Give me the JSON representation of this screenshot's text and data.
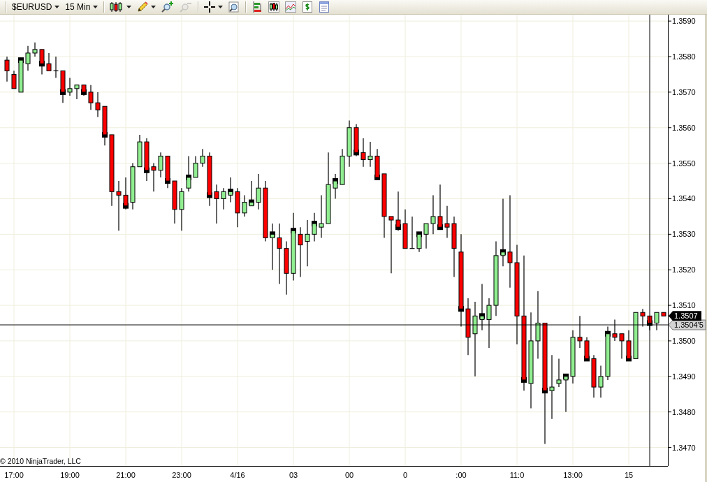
{
  "toolbar": {
    "instrument": {
      "label": "$EURUSD"
    },
    "interval": {
      "label": "15 Min"
    },
    "tools": [
      {
        "disabled": false
      },
      {
        "disabled": false
      },
      {
        "disabled": false
      },
      {
        "disabled": true
      },
      {
        "disabled": false
      },
      {
        "disabled": false
      },
      {
        "disabled": false
      },
      {
        "disabled": false
      },
      {
        "disabled": false
      },
      {
        "disabled": false
      },
      {
        "disabled": false
      }
    ]
  },
  "chart": {
    "copyright": "© 2010 NinjaTrader, LLC",
    "bar_marks": [
      false,
      false,
      true,
      false,
      false,
      true,
      false,
      false,
      true,
      false,
      false,
      true,
      false,
      false,
      true,
      false,
      false,
      true,
      false,
      false,
      true,
      false,
      false,
      true,
      false,
      false,
      true,
      false,
      false,
      true,
      false,
      false,
      true,
      false,
      false,
      true,
      false,
      false,
      true,
      false,
      false,
      true,
      false,
      false,
      true,
      false,
      false,
      true,
      false,
      false,
      true,
      false,
      false,
      true,
      false,
      false,
      true,
      false,
      false,
      true,
      false,
      false,
      true,
      false,
      false,
      true,
      false,
      false,
      true,
      false,
      false,
      true,
      false,
      false,
      true,
      false,
      false,
      true,
      false,
      false,
      true,
      false,
      false,
      true,
      false,
      false,
      true,
      false,
      false,
      true,
      false,
      false,
      true,
      false,
      false
    ],
    "chart_data": {
      "type": "candlestick",
      "categories": [
        null,
        "17:00",
        null,
        null,
        null,
        null,
        null,
        null,
        null,
        "19:00",
        null,
        null,
        null,
        null,
        null,
        null,
        null,
        "21:00",
        null,
        null,
        null,
        null,
        null,
        null,
        null,
        "23:00",
        null,
        null,
        null,
        null,
        null,
        null,
        null,
        "4/16",
        null,
        null,
        null,
        null,
        null,
        null,
        null,
        "03",
        null,
        null,
        null,
        null,
        null,
        null,
        null,
        "00",
        null,
        null,
        null,
        null,
        null,
        null,
        null,
        "0",
        null,
        null,
        null,
        null,
        null,
        null,
        null,
        ":00",
        null,
        null,
        null,
        null,
        null,
        null,
        null,
        "11:0",
        null,
        null,
        null,
        null,
        null,
        null,
        null,
        "13:00",
        null,
        null,
        null,
        null,
        null,
        null,
        null,
        "15",
        null,
        null,
        null,
        null,
        null
      ],
      "ylim": [
        1.34648,
        1.35918
      ],
      "yticks": [
        {
          "value": 1.359,
          "label": "1.3590"
        },
        {
          "value": 1.358,
          "label": "1.3580"
        },
        {
          "value": 1.357,
          "label": "1.3570"
        },
        {
          "value": 1.356,
          "label": "1.3560"
        },
        {
          "value": 1.355,
          "label": "1.3550"
        },
        {
          "value": 1.354,
          "label": "1.3540"
        },
        {
          "value": 1.353,
          "label": "1.3530"
        },
        {
          "value": 1.352,
          "label": "1.3520"
        },
        {
          "value": 1.351,
          "label": "1.3510"
        },
        {
          "value": 1.35,
          "label": "1.3500"
        },
        {
          "value": 1.349,
          "label": "1.3490"
        },
        {
          "value": 1.348,
          "label": "1.3480"
        },
        {
          "value": 1.347,
          "label": "1.3470"
        }
      ],
      "ohlc": [
        [
          1.3579,
          1.358,
          1.3573,
          1.3576
        ],
        [
          1.3575,
          1.3576,
          1.3571,
          1.3571
        ],
        [
          1.357,
          1.3579,
          1.357,
          1.3579
        ],
        [
          1.3578,
          1.3583,
          1.3576,
          1.3581
        ],
        [
          1.3581,
          1.3584,
          1.358,
          1.3582
        ],
        [
          1.3582,
          1.3582,
          1.3575,
          1.3578
        ],
        [
          1.3578,
          1.3581,
          1.3576,
          1.3576
        ],
        [
          1.3576,
          1.358,
          1.3574,
          1.3576
        ],
        [
          1.3576,
          1.3576,
          1.3567,
          1.357
        ],
        [
          1.357,
          1.3574,
          1.3569,
          1.3571
        ],
        [
          1.3571,
          1.3572,
          1.3568,
          1.3572
        ],
        [
          1.3572,
          1.3572,
          1.3569,
          1.357
        ],
        [
          1.357,
          1.3572,
          1.3565,
          1.3567
        ],
        [
          1.3567,
          1.357,
          1.3563,
          1.3565
        ],
        [
          1.3566,
          1.3566,
          1.3555,
          1.3558
        ],
        [
          1.3558,
          1.3558,
          1.3538,
          1.3542
        ],
        [
          1.3542,
          1.3545,
          1.3531,
          1.3541
        ],
        [
          1.3541,
          1.3546,
          1.3537,
          1.3538
        ],
        [
          1.3539,
          1.355,
          1.3537,
          1.3549
        ],
        [
          1.3549,
          1.3558,
          1.3549,
          1.3556
        ],
        [
          1.3556,
          1.3557,
          1.3545,
          1.3548
        ],
        [
          1.3549,
          1.355,
          1.3542,
          1.3548
        ],
        [
          1.3548,
          1.3553,
          1.3546,
          1.3552
        ],
        [
          1.3552,
          1.3552,
          1.3543,
          1.3545
        ],
        [
          1.3545,
          1.3545,
          1.3533,
          1.3537
        ],
        [
          1.3537,
          1.3543,
          1.3531,
          1.3542
        ],
        [
          1.3543,
          1.3552,
          1.3542,
          1.3546
        ],
        [
          1.3546,
          1.3552,
          1.3546,
          1.355
        ],
        [
          1.355,
          1.3554,
          1.3549,
          1.3552
        ],
        [
          1.3552,
          1.3553,
          1.3538,
          1.3541
        ],
        [
          1.3542,
          1.3544,
          1.3533,
          1.354
        ],
        [
          1.354,
          1.3543,
          1.3537,
          1.3542
        ],
        [
          1.3541,
          1.3546,
          1.3539,
          1.3542
        ],
        [
          1.3542,
          1.3543,
          1.3532,
          1.3536
        ],
        [
          1.3536,
          1.3541,
          1.3535,
          1.3539
        ],
        [
          1.3538,
          1.3545,
          1.3538,
          1.3539
        ],
        [
          1.3539,
          1.3547,
          1.3537,
          1.3543
        ],
        [
          1.3543,
          1.3545,
          1.3528,
          1.3529
        ],
        [
          1.3529,
          1.3533,
          1.352,
          1.353
        ],
        [
          1.3529,
          1.3533,
          1.3516,
          1.3526
        ],
        [
          1.3526,
          1.3528,
          1.3513,
          1.3519
        ],
        [
          1.3519,
          1.3536,
          1.3517,
          1.3531
        ],
        [
          1.353,
          1.3532,
          1.3518,
          1.3527
        ],
        [
          1.3528,
          1.3534,
          1.3521,
          1.353
        ],
        [
          1.353,
          1.3536,
          1.3528,
          1.3533
        ],
        [
          1.3532,
          1.3541,
          1.3529,
          1.3533
        ],
        [
          1.3533,
          1.3553,
          1.3533,
          1.3544
        ],
        [
          1.3543,
          1.3547,
          1.354,
          1.3545
        ],
        [
          1.3544,
          1.3554,
          1.3544,
          1.3552
        ],
        [
          1.3552,
          1.3562,
          1.3549,
          1.356
        ],
        [
          1.356,
          1.3561,
          1.3552,
          1.3553
        ],
        [
          1.3553,
          1.3557,
          1.3549,
          1.3551
        ],
        [
          1.3551,
          1.3556,
          1.3549,
          1.3552
        ],
        [
          1.3552,
          1.3554,
          1.3546,
          1.3546
        ],
        [
          1.3547,
          1.3547,
          1.3529,
          1.3535
        ],
        [
          1.3535,
          1.3535,
          1.3519,
          1.3534
        ],
        [
          1.3534,
          1.3542,
          1.3531,
          1.3532
        ],
        [
          1.3533,
          1.3537,
          1.3526,
          1.3526
        ],
        [
          1.3526,
          1.3535,
          1.3526,
          1.3526
        ],
        [
          1.3526,
          1.353,
          1.3525,
          1.353
        ],
        [
          1.353,
          1.3533,
          1.3526,
          1.3533
        ],
        [
          1.3533,
          1.3541,
          1.353,
          1.3535
        ],
        [
          1.3535,
          1.3544,
          1.3532,
          1.3532
        ],
        [
          1.3533,
          1.3538,
          1.3529,
          1.3532
        ],
        [
          1.3533,
          1.3535,
          1.3518,
          1.3526
        ],
        [
          1.3525,
          1.353,
          1.3504,
          1.3509
        ],
        [
          1.3509,
          1.3512,
          1.3496,
          1.3501
        ],
        [
          1.3502,
          1.3511,
          1.349,
          1.3507
        ],
        [
          1.3506,
          1.3516,
          1.3503,
          1.3507
        ],
        [
          1.3506,
          1.3512,
          1.3498,
          1.351
        ],
        [
          1.351,
          1.3528,
          1.3507,
          1.3524
        ],
        [
          1.3524,
          1.354,
          1.3521,
          1.3525
        ],
        [
          1.3525,
          1.3541,
          1.3515,
          1.3522
        ],
        [
          1.3522,
          1.3527,
          1.3499,
          1.3507
        ],
        [
          1.3507,
          1.3524,
          1.3486,
          1.3489
        ],
        [
          1.3488,
          1.3508,
          1.3481,
          1.35
        ],
        [
          1.35,
          1.3514,
          1.3495,
          1.3505
        ],
        [
          1.3505,
          1.3505,
          1.3471,
          1.3486
        ],
        [
          1.3486,
          1.3496,
          1.3478,
          1.3487
        ],
        [
          1.3488,
          1.3495,
          1.3487,
          1.3489
        ],
        [
          1.3489,
          1.349,
          1.348,
          1.349
        ],
        [
          1.349,
          1.3503,
          1.3488,
          1.3501
        ],
        [
          1.3501,
          1.3507,
          1.3498,
          1.35
        ],
        [
          1.35,
          1.3501,
          1.3495,
          1.3495
        ],
        [
          1.3495,
          1.3496,
          1.3484,
          1.3487
        ],
        [
          1.3487,
          1.3493,
          1.3484,
          1.349
        ],
        [
          1.349,
          1.3504,
          1.3489,
          1.3502
        ],
        [
          1.3502,
          1.3506,
          1.35,
          1.3501
        ],
        [
          1.3502,
          1.3502,
          1.3495,
          1.35
        ],
        [
          1.35,
          1.3503,
          1.3495,
          1.3495
        ],
        [
          1.3495,
          1.3508,
          1.3495,
          1.3508
        ],
        [
          1.3508,
          1.3509,
          1.3504,
          1.3507
        ],
        [
          1.3507,
          1.3507,
          1.3503,
          1.3505
        ],
        [
          1.3505,
          1.3508,
          1.3503,
          1.3508
        ],
        [
          1.3508,
          1.3508,
          1.3507,
          1.3507
        ]
      ],
      "grid": true,
      "ref_lines": [
        {
          "axis": "y",
          "value": 1.35045,
          "label": "1.3504'5"
        }
      ],
      "annotations": [
        "1.3507"
      ]
    }
  }
}
